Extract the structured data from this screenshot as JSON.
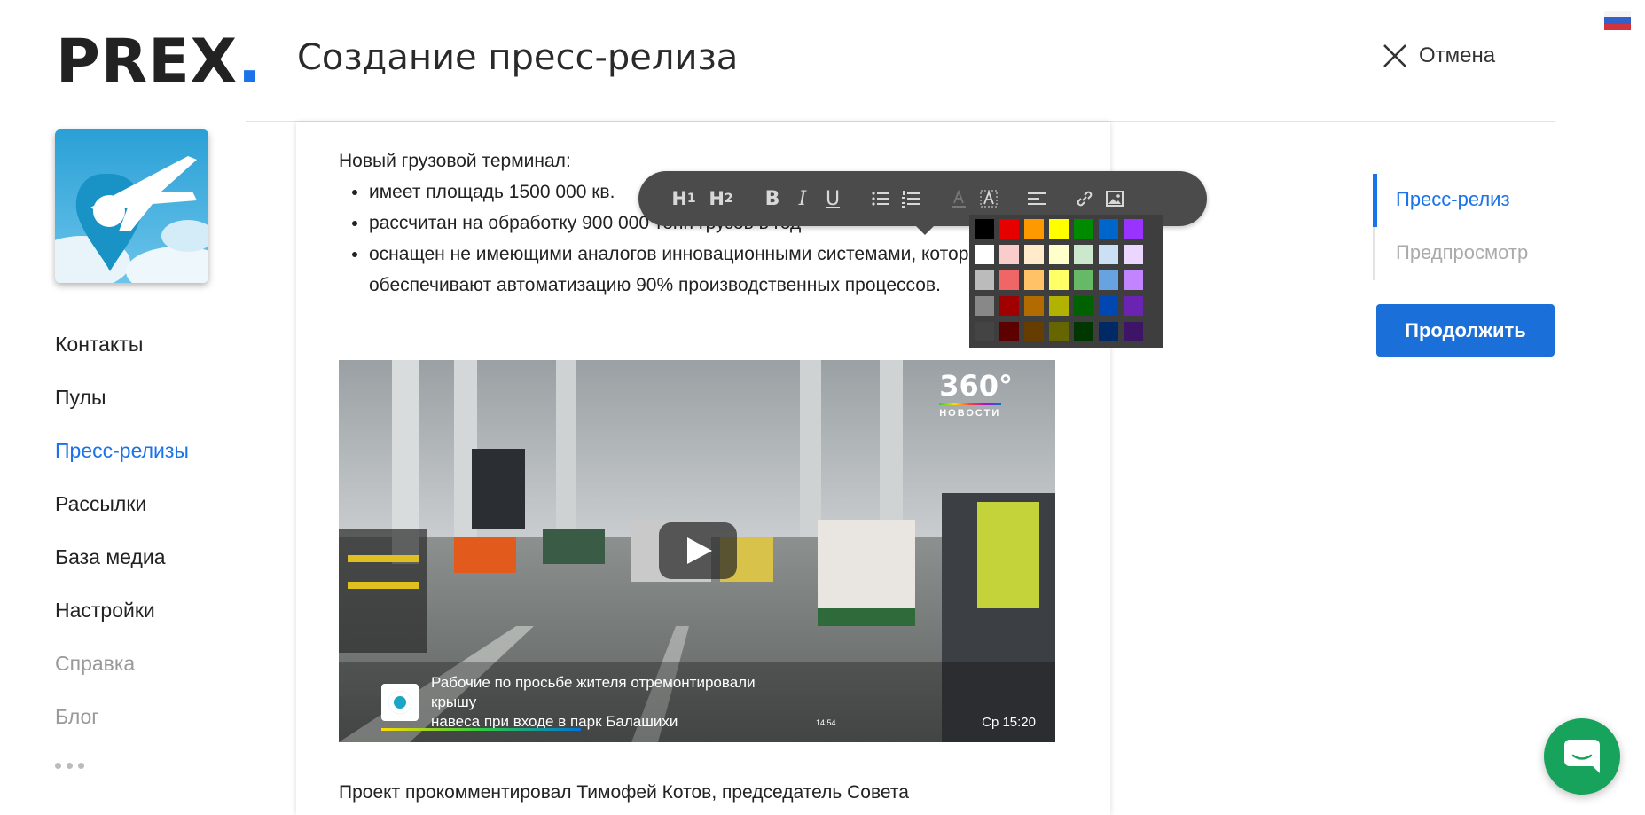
{
  "logo": {
    "text": "PREX",
    "dot": "."
  },
  "header": {
    "title": "Создание пресс-релиза",
    "cancel_label": "Отмена"
  },
  "sidebar": {
    "items": [
      {
        "label": "Контакты",
        "state": "normal"
      },
      {
        "label": "Пулы",
        "state": "normal"
      },
      {
        "label": "Пресс-релизы",
        "state": "active"
      },
      {
        "label": "Рассылки",
        "state": "normal"
      },
      {
        "label": "База медиа",
        "state": "normal"
      },
      {
        "label": "Настройки",
        "state": "normal"
      },
      {
        "label": "Справка",
        "state": "muted"
      },
      {
        "label": "Блог",
        "state": "muted"
      }
    ]
  },
  "editor": {
    "intro": "Новый грузовой терминал:",
    "bullets": [
      "имеет площадь 1500 000 кв.",
      "рассчитан на обработку 900 000 тонн грузов в год",
      "оснащен не имеющими аналогов инновационными системами, которые обеспечивают автоматизацию 90% производственных процессов."
    ],
    "video": {
      "brand_big": "360°",
      "brand_small": "НОВОСТИ",
      "news_line1": "Рабочие по просьбе жителя отремонтировали крышу",
      "news_line2": "навеса при входе в парк Балашихи",
      "small_time": "14:54",
      "clock": "Ср 15:20"
    },
    "bottom_text": "Проект прокомментировал Тимофей Котов, председатель Совета"
  },
  "toolbar": {
    "h1": "H",
    "h1_sub": "1",
    "h2": "H",
    "h2_sub": "2",
    "bold": "B",
    "italic": "I",
    "underline": "U"
  },
  "palette": {
    "rows": [
      [
        "#000000",
        "#e60000",
        "#ff9900",
        "#ffff00",
        "#008a00",
        "#0066cc",
        "#9933ff"
      ],
      [
        "#ffffff",
        "#facccc",
        "#ffebcc",
        "#ffffcc",
        "#cce8cc",
        "#cce0f5",
        "#ebd6ff"
      ],
      [
        "#bbbbbb",
        "#f06666",
        "#ffc266",
        "#ffff66",
        "#66b966",
        "#66a3e0",
        "#c285ff"
      ],
      [
        "#888888",
        "#a10000",
        "#b26b00",
        "#b2b200",
        "#006100",
        "#0047b2",
        "#6b24b2"
      ],
      [
        "#444444",
        "#5c0000",
        "#663d00",
        "#666600",
        "#003700",
        "#002966",
        "#3d1466"
      ]
    ]
  },
  "steps": [
    {
      "label": "Пресс-релиз",
      "state": "active"
    },
    {
      "label": "Предпросмотр",
      "state": "inactive"
    }
  ],
  "actions": {
    "continue_label": "Продолжить"
  },
  "colors": {
    "accent": "#1a73e8",
    "button": "#1a6fd8",
    "chat": "#18a35c",
    "toolbar": "#4b4b4b"
  }
}
